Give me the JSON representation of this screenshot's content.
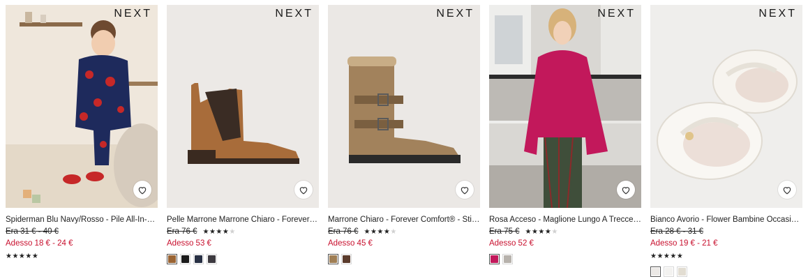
{
  "brand_logo": "NEXT",
  "products": [
    {
      "title": "Spiderman Blu Navy/Rosso - Pile All-In-One (…",
      "was_price": "Era 31 € - 40 €",
      "now_price": "Adesso 18 € - 24 €",
      "rating": 5,
      "rating_position": "below",
      "swatches": []
    },
    {
      "title": "Pelle Marrone Marrone Chiaro - Forever Comf…",
      "was_price": "Era 76 €",
      "now_price": "Adesso 53 €",
      "rating": 4.5,
      "rating_position": "inline",
      "swatches": [
        "#9a6433",
        "#1b1b1b",
        "#283044",
        "#3d3a40"
      ],
      "selected_swatch": 0
    },
    {
      "title": "Marrone Chiaro - Forever Comfort® - Stivali …",
      "was_price": "Era 76 €",
      "now_price": "Adesso 45 €",
      "rating": 4,
      "rating_position": "inline",
      "swatches": [
        "#a07f55",
        "#5b3c2c"
      ],
      "selected_swatch": 0
    },
    {
      "title": "Rosa Acceso - Maglione Lungo A Trecce Con C…",
      "was_price": "Era 75 €",
      "now_price": "Adesso 52 €",
      "rating": 4,
      "rating_position": "inline",
      "swatches": [
        "#c2185b",
        "#b7b2ac"
      ],
      "selected_swatch": 0
    },
    {
      "title": "Bianco Avorio - Flower Bambine Occasion Ma…",
      "was_price": "Era 28 € - 31 €",
      "now_price": "Adesso 19 € - 21 €",
      "rating": 5,
      "rating_position": "below",
      "swatches": [
        "#ece9e6",
        "#f3f2f0",
        "#e2ddd2"
      ],
      "selected_swatch": 0
    }
  ],
  "colors": {
    "sale_red": "#c8102e",
    "text": "#222222"
  },
  "icons": {
    "favourite": "heart-outline-icon",
    "rating": "star-icon"
  }
}
